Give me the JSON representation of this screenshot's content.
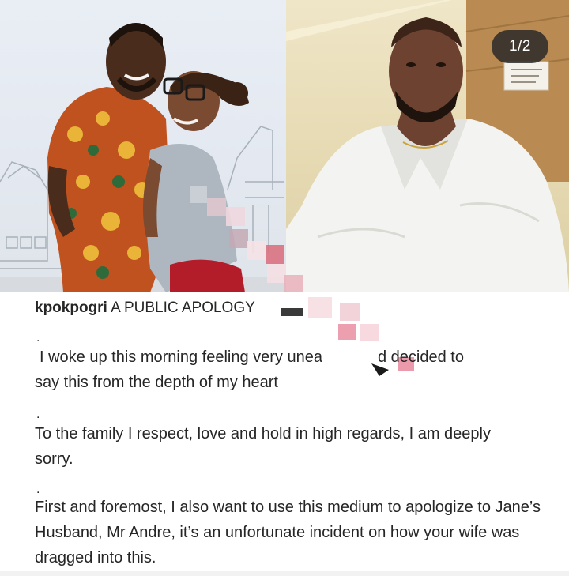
{
  "carousel": {
    "counter": "1/2"
  },
  "post": {
    "username": "kpokpogri",
    "caption_title": "A PUBLIC APOLOGY",
    "separator": ".",
    "paragraph1_line1_start": "I woke up this morning feeling very unea",
    "paragraph1_line1_end": "d decided to",
    "paragraph1_line2": "say this from the depth of my heart",
    "paragraph2": "To the family I respect, love and hold in high regards, I am deeply sorry.",
    "paragraph3": "First and foremost, I also want to use this medium to apologize to Jane’s Husband, Mr Andre, it’s an unfortunate incident on how your wife was dragged into this."
  },
  "colors": {
    "text": "#262626",
    "badge_bg": "#262626",
    "badge_text": "#ffffff"
  }
}
